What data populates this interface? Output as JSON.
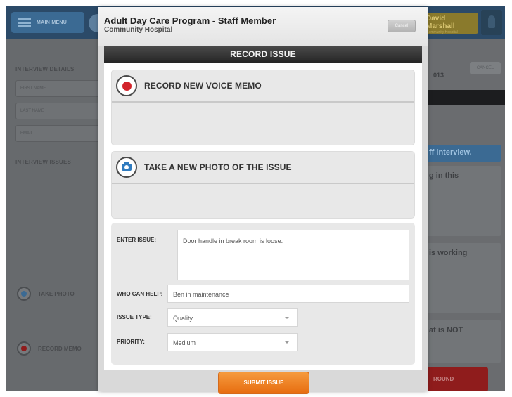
{
  "header": {
    "menu_label": "MAIN MENU",
    "user_name": "David Marshall",
    "user_sub": "Community Hospital"
  },
  "left": {
    "interview_details": "INTERVIEW DETAILS",
    "first_name": "FIRST NAME",
    "last_name": "LAST NAME",
    "email": "EMAIL",
    "interview_issues": "INTERVIEW ISSUES",
    "take_photo": "TAKE PHOTO",
    "record_memo": "RECORD MEMO"
  },
  "right": {
    "date": "013",
    "cancel": "CANCEL",
    "banner": "ff interview.",
    "card1": "g in this",
    "card2": "is working",
    "card3": "at is NOT",
    "red_btn": "ROUND"
  },
  "modal": {
    "title": "Adult Day Care Program - Staff Member",
    "subtitle": "Community Hospital",
    "cancel_label": "Cancel",
    "section_title": "RECORD ISSUE",
    "voice_label": "RECORD NEW VOICE MEMO",
    "photo_label": "TAKE A NEW PHOTO OF THE ISSUE",
    "enter_issue_label": "ENTER ISSUE:",
    "enter_issue_value": "Door handle in break room is loose.",
    "who_label": "WHO CAN HELP:",
    "who_value": "Ben in maintenance",
    "type_label": "ISSUE TYPE:",
    "type_value": "Quality",
    "priority_label": "PRIORITY:",
    "priority_value": "Medium",
    "submit_label": "SUBMIT ISSUE"
  },
  "colors": {
    "accent_orange": "#ee7f22",
    "record_red": "#d2232a",
    "camera_blue": "#2f7bbf"
  }
}
